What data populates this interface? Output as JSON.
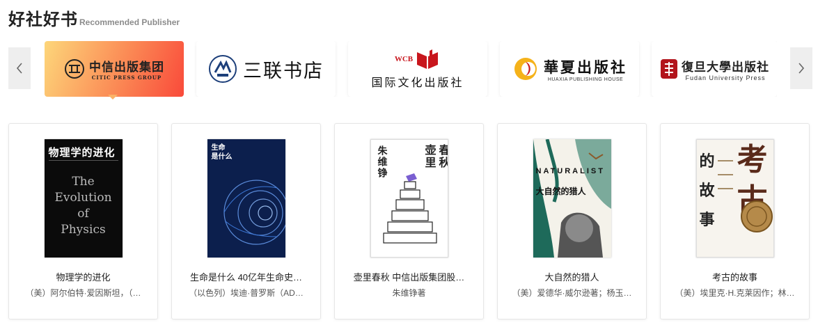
{
  "header": {
    "title": "好社好书",
    "subtitle": "Recommended Publisher"
  },
  "icons": {
    "prev": "chevron-left-icon",
    "next": "chevron-right-icon"
  },
  "colors": {
    "active_gradient_start": "#fdd67a",
    "active_gradient_end": "#f94a3a",
    "arrow_bg": "#eeeeee"
  },
  "publishers": [
    {
      "name": "中信出版集团",
      "name_en": "CITIC PRESS GROUP",
      "active": true
    },
    {
      "name": "三联书店",
      "emblem": "三联书店"
    },
    {
      "name": "国际文化出版社",
      "emblem": "WCB"
    },
    {
      "name": "華夏出版社",
      "name_en": "HUAXIA PUBLISHING HOUSE"
    },
    {
      "name": "復旦大學出版社",
      "name_en": "Fudan University Press"
    }
  ],
  "books": [
    {
      "title": "物理学的进化",
      "author": "（美）阿尔伯特·爱因斯坦，（…",
      "cover": {
        "title": "物理学的进化",
        "en": [
          "The",
          "Evolution",
          "of",
          "Physics"
        ]
      }
    },
    {
      "title": "生命是什么 40亿年生命史…",
      "author": "（以色列）埃迪·普罗斯（AD…",
      "cover": {
        "title_line1": "生命",
        "title_line2": "是什么"
      }
    },
    {
      "title": "壶里春秋 中信出版集团股…",
      "author": "朱维铮著",
      "cover": {
        "author": "朱维铮",
        "title1": "壶里",
        "title2": "春秋"
      }
    },
    {
      "title": "大自然的猎人",
      "author": "（美）爱德华·威尔逊著；杨玉…",
      "cover": {
        "en": "NATURALIST",
        "title": "大自然的猎人"
      }
    },
    {
      "title": "考古的故事",
      "author": "（美）埃里克·H.克莱因作；林…",
      "cover": {
        "left": [
          "的",
          "故",
          "事"
        ],
        "big": [
          "考",
          "古"
        ]
      }
    }
  ]
}
